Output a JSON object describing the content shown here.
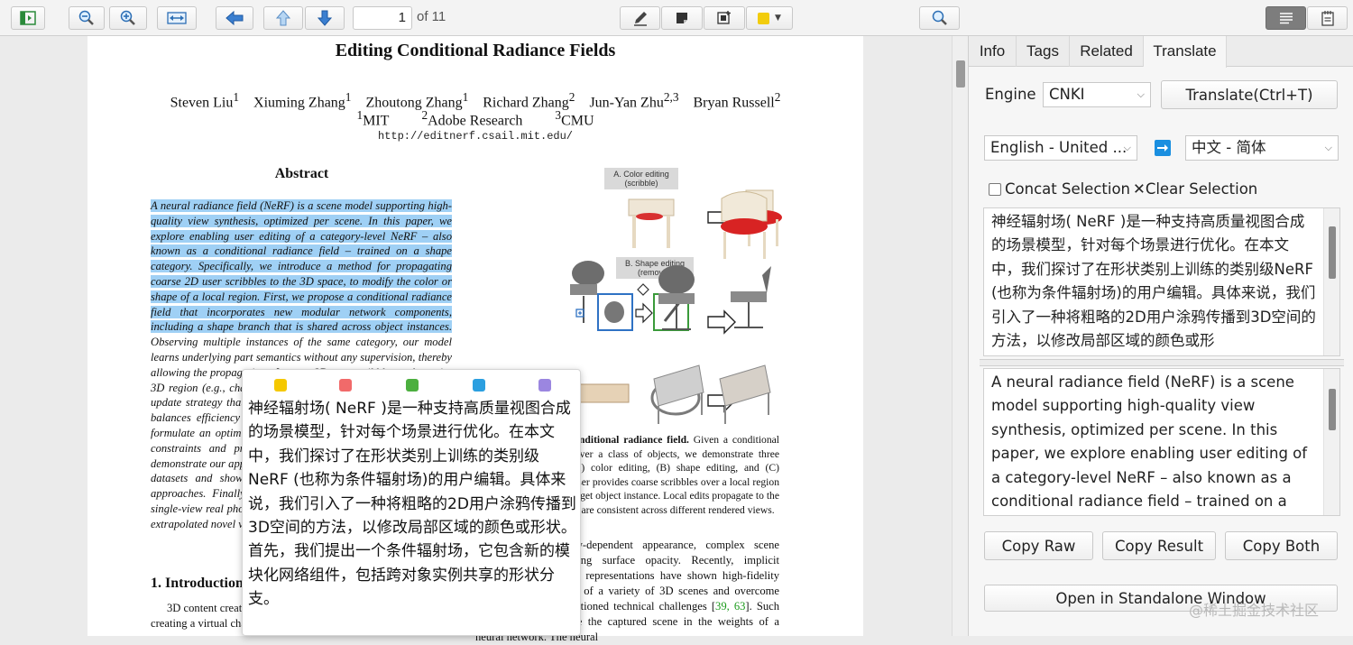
{
  "toolbar": {
    "page_current": "1",
    "page_total_label": "of 11",
    "highlight_color": "#f2cc0c"
  },
  "paper": {
    "title": "Editing Conditional Radiance Fields",
    "authors": [
      "Steven Liu",
      "Xiuming Zhang",
      "Zhoutong Zhang",
      "Richard Zhang",
      "Jun-Yan Zhu",
      "Bryan Russell"
    ],
    "author_sups": [
      "1",
      "1",
      "1",
      "2",
      "2,3",
      "2"
    ],
    "affiliations": [
      {
        "sup": "1",
        "name": "MIT"
      },
      {
        "sup": "2",
        "name": "Adobe Research"
      },
      {
        "sup": "3",
        "name": "CMU"
      }
    ],
    "url": "http://editnerf.csail.mit.edu/",
    "abstract_heading": "Abstract",
    "abstract_highlighted": "A neural radiance field (NeRF) is a scene model supporting high-quality view synthesis, optimized per scene. In this paper, we explore enabling user editing of a category-level NeRF – also known as a conditional radiance field – trained on a shape category. Specifically, we introduce a method for propagating coarse 2D user scribbles to the 3D space, to modify the color or shape of a local region. First, we propose a conditional radiance field that incorporates new modular network components, including a shape branch that is shared across object instances.",
    "abstract_rest": "Observing multiple instances of the same category, our model learns underlying part semantics without any supervision, thereby allowing the propagation of coarse 2D user scribbles to the entire 3D region (e.g., chair seat). Next, we propose a hybrid network update strategy that targets specific network components, which balances efficiency and accuracy. During user interaction, we formulate an optimization problem that both satisfies the user's constraints and preserves the original object structure. We demonstrate our approach on various editing tasks over 3D shape datasets and show that it outperforms prior neural editing approaches. Finally, we edit the appearance and shape of a single-view real photograph and show that the edit propagates to extrapolated novel views.",
    "intro_heading": "1. Introduction",
    "intro_text": "3D content creation often involves editing 3D assets, such as creating a virtual chair for video games or a visualization …",
    "fig_label_a": "A. Color editing\n(scribble)",
    "fig_label_b": "B. Shape editing\n(removal)",
    "caption_bold": "Figure 1: Editing a conditional radiance field.",
    "caption_rest": "Given a conditional radiance field trained over a class of objects, we demonstrate three editing applications: (A) color editing, (B) shape editing, and (C) color/shape transfer. A user provides coarse scribbles over a local region of interest or selects a target object instance. Local edits propagate to the desired region in 3D and are consistent across different rendered views.",
    "right_col": "radiance fields, view-dependent appearance, complex scene geometry, and varying surface opacity. Recently, implicit continuous volumetric representations have shown high-fidelity capture and rendering of a variety of 3D scenes and overcome many of the aforementioned technical challenges [",
    "right_cites": "39, 63",
    "right_col_2": "]. Such representations encode the captured scene in the weights of a neural network. The neural"
  },
  "popup": {
    "colors": [
      "#f5c800",
      "#f16a6a",
      "#4caf3f",
      "#2b9fe0",
      "#9b86e0"
    ],
    "text": "神经辐射场( NeRF )是一种支持高质量视图合成的场景模型，针对每个场景进行优化。在本文中，我们探讨了在形状类别上训练的类别级NeRF (也称为条件辐射场)的用户编辑。具体来说，我们引入了一种将粗略的2D用户涂鸦传播到3D空间的方法，以修改局部区域的颜色或形状。首先，我们提出一个条件辐射场，它包含新的模块化网络组件，包括跨对象实例共享的形状分支。"
  },
  "sidebar": {
    "tabs": [
      "Info",
      "Tags",
      "Related",
      "Translate"
    ],
    "active_tab": "Translate",
    "engine_label": "Engine",
    "engine_value": "CNKI",
    "translate_button": "Translate(Ctrl+T)",
    "source_lang": "English - United ...",
    "target_lang": "中文 - 简体",
    "concat_label": "Concat Selection",
    "clear_label": "✕Clear Selection",
    "result_text": "神经辐射场( NeRF )是一种支持高质量视图合成的场景模型，针对每个场景进行优化。在本文中，我们探讨了在形状类别上训练的类别级NeRF (也称为条件辐射场)的用户编辑。具体来说，我们引入了一种将粗略的2D用户涂鸦传播到3D空间的方法，以修改局部区域的颜色或形",
    "raw_text": "A neural radiance field (NeRF) is a scene model supporting high-quality view synthesis, optimized per scene. In this paper, we explore enabling user editing of a category-level NeRF – also known as a conditional radiance field – trained on a",
    "copy_raw": "Copy Raw",
    "copy_result": "Copy Result",
    "copy_both": "Copy Both",
    "standalone": "Open in Standalone Window"
  },
  "watermark": "@稀土掘金技术社区"
}
